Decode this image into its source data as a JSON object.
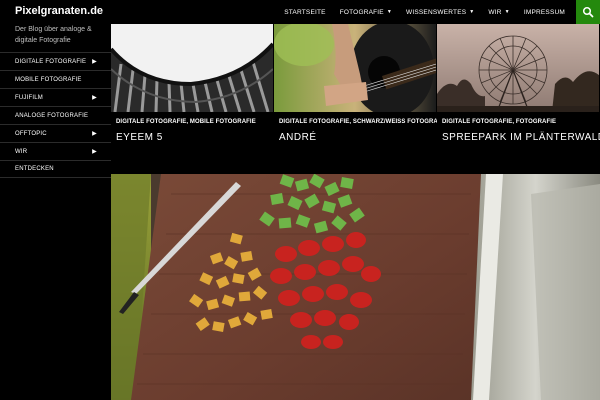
{
  "site": {
    "title": "Pixelgranaten.de",
    "tagline": "Der Blog über analoge & digitale Fotografie"
  },
  "topnav": {
    "items": [
      {
        "label": "STARTSEITE",
        "has_dropdown": false
      },
      {
        "label": "FOTOGRAFIE",
        "has_dropdown": true
      },
      {
        "label": "WISSENSWERTES",
        "has_dropdown": true
      },
      {
        "label": "WIR",
        "has_dropdown": true
      },
      {
        "label": "IMPRESSUM",
        "has_dropdown": false
      }
    ],
    "search_icon": "search-icon"
  },
  "sidebar": {
    "items": [
      {
        "label": "DIGITALE FOTOGRAFIE",
        "has_submenu": true
      },
      {
        "label": "MOBILE FOTOGRAFIE",
        "has_submenu": false
      },
      {
        "label": "FUJIFILM",
        "has_submenu": true
      },
      {
        "label": "ANALOGE FOTOGRAFIE",
        "has_submenu": false
      },
      {
        "label": "OFFTOPIC",
        "has_submenu": true
      },
      {
        "label": "WIR",
        "has_submenu": true
      },
      {
        "label": "ENTDECKEN",
        "has_submenu": false
      }
    ]
  },
  "featured": [
    {
      "categories": "DIGITALE FOTOGRAFIE, MOBILE FOTOGRAFIE",
      "title": "EYEEM 5"
    },
    {
      "categories": "DIGITALE FOTOGRAFIE, SCHWARZ/WEISS FOTOGRAFIE",
      "title": "ANDRÉ"
    },
    {
      "categories": "DIGITALE FOTOGRAFIE, FOTOGRAFIE",
      "title": "SPREEPARK IM PLÄNTERWALD"
    }
  ],
  "colors": {
    "background": "#000000",
    "accent": "#24890d",
    "text": "#ffffff",
    "tagline": "#bfbfbf"
  }
}
